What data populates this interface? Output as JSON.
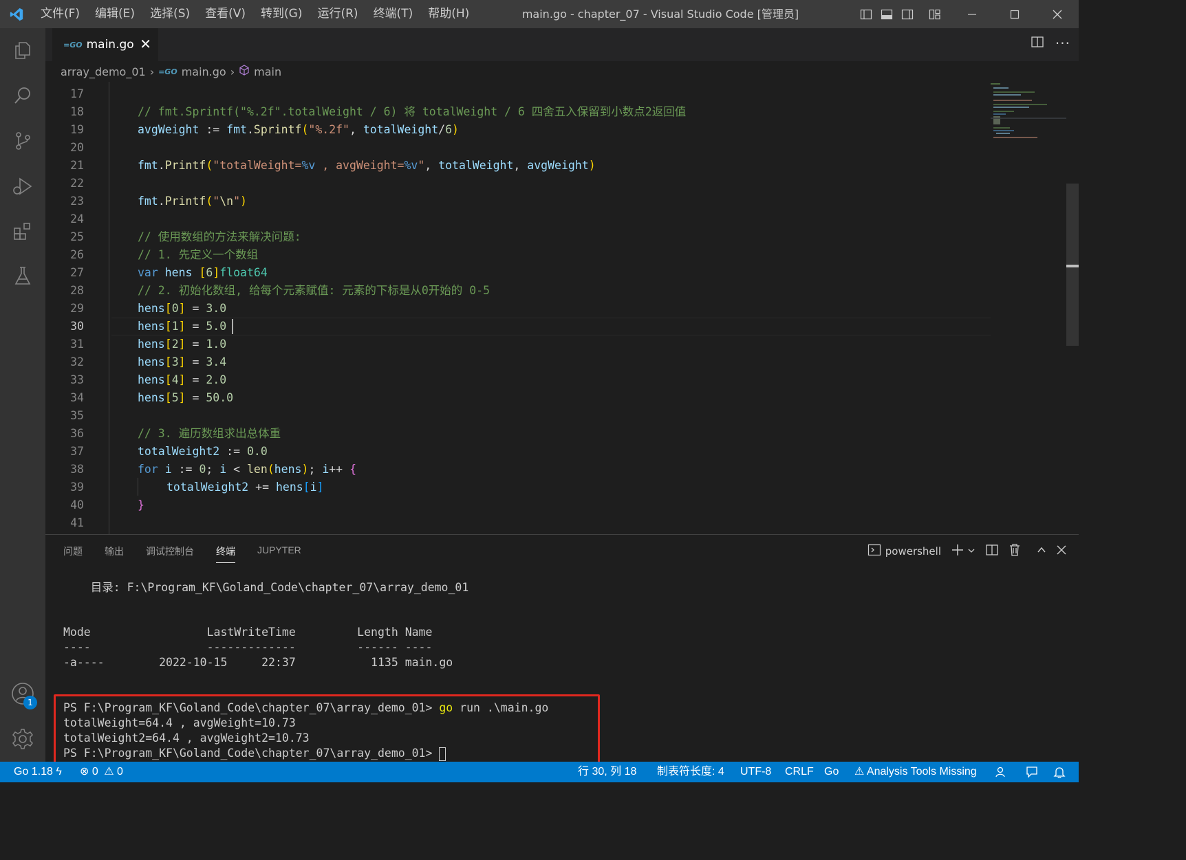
{
  "titlebar": {
    "menus": [
      "文件(F)",
      "编辑(E)",
      "选择(S)",
      "查看(V)",
      "转到(G)",
      "运行(R)",
      "终端(T)",
      "帮助(H)"
    ],
    "window_title": "main.go - chapter_07 - Visual Studio Code [管理员]"
  },
  "tab": {
    "label": "main.go",
    "icon": "go-file-icon"
  },
  "breadcrumb": {
    "folder": "array_demo_01",
    "file": "main.go",
    "symbol": "main"
  },
  "editor": {
    "active_line": 30,
    "lines": [
      {
        "n": "17",
        "t": ""
      },
      {
        "n": "18",
        "t": "// fmt.Sprintf(\"%.2f\".totalWeight / 6) 将 totalWeight / 6 四舍五入保留到小数点2返回值"
      },
      {
        "n": "19",
        "t": "avgWeight := fmt.Sprintf(\"%.2f\", totalWeight/6)"
      },
      {
        "n": "20",
        "t": ""
      },
      {
        "n": "21",
        "t": "fmt.Printf(\"totalWeight=%v , avgWeight=%v\", totalWeight, avgWeight)"
      },
      {
        "n": "22",
        "t": ""
      },
      {
        "n": "23",
        "t": "fmt.Printf(\"\\n\")"
      },
      {
        "n": "24",
        "t": ""
      },
      {
        "n": "25",
        "t": "// 使用数组的方法来解决问题:"
      },
      {
        "n": "26",
        "t": "// 1. 先定义一个数组"
      },
      {
        "n": "27",
        "t": "var hens [6]float64"
      },
      {
        "n": "28",
        "t": "// 2. 初始化数组, 给每个元素赋值: 元素的下标是从0开始的 0-5"
      },
      {
        "n": "29",
        "t": "hens[0] = 3.0"
      },
      {
        "n": "30",
        "t": "hens[1] = 5.0"
      },
      {
        "n": "31",
        "t": "hens[2] = 1.0"
      },
      {
        "n": "32",
        "t": "hens[3] = 3.4"
      },
      {
        "n": "33",
        "t": "hens[4] = 2.0"
      },
      {
        "n": "34",
        "t": "hens[5] = 50.0"
      },
      {
        "n": "35",
        "t": ""
      },
      {
        "n": "36",
        "t": "// 3. 遍历数组求出总体重"
      },
      {
        "n": "37",
        "t": "totalWeight2 := 0.0"
      },
      {
        "n": "38",
        "t": "for i := 0; i < len(hens); i++ {"
      },
      {
        "n": "39",
        "t": "totalWeight2 += hens[i]"
      },
      {
        "n": "40",
        "t": "}"
      },
      {
        "n": "41",
        "t": ""
      }
    ]
  },
  "panel": {
    "tabs": [
      "问题",
      "输出",
      "调试控制台",
      "终端",
      "JUPYTER"
    ],
    "active_tab": "终端",
    "shell": "powershell",
    "terminal_lines": [
      "    目录: F:\\Program_KF\\Goland_Code\\chapter_07\\array_demo_01",
      "Mode                 LastWriteTime         Length Name",
      "----                 -------------         ------ ----",
      "-a----        2022-10-15     22:37           1135 main.go",
      "PS F:\\Program_KF\\Goland_Code\\chapter_07\\array_demo_01> ",
      "go",
      " run .\\main.go",
      "totalWeight=64.4 , avgWeight=10.73",
      "totalWeight2=64.4 , avgWeight2=10.73",
      "PS F:\\Program_KF\\Goland_Code\\chapter_07\\array_demo_01> "
    ]
  },
  "accounts_badge": "1",
  "statusbar": {
    "go_version": "Go 1.18",
    "errors": "0",
    "warnings": "0",
    "position": "行 30, 列 18",
    "indent": "制表符长度: 4",
    "encoding": "UTF-8",
    "eol": "CRLF",
    "language": "Go",
    "analysis": "Analysis Tools Missing"
  },
  "colors": {
    "accent": "#007acc",
    "highlight_box": "#e0281f"
  }
}
